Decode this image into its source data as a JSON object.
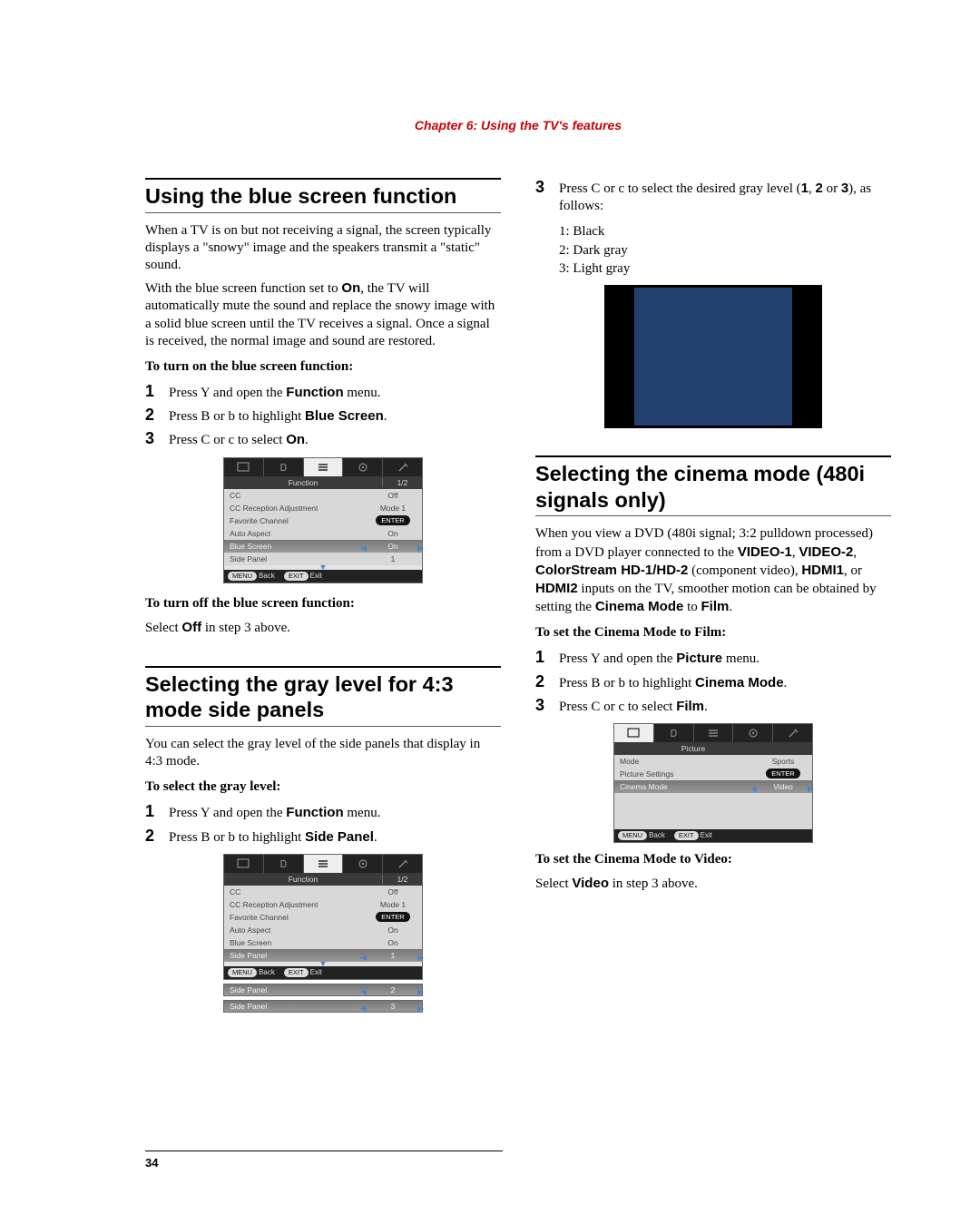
{
  "chapter_title": "Chapter 6: Using the TV's features",
  "page_number": "34",
  "left": {
    "sec1_title": "Using the blue screen function",
    "sec1_p1": "When a TV is on but not receiving a signal, the screen typically displays a \"snowy\" image and the speakers transmit a \"static\" sound.",
    "sec1_p2a": "With the blue screen function set to ",
    "sec1_p2b": "On",
    "sec1_p2c": ", the TV will automatically mute the sound and replace the snowy image with a solid blue screen until the TV receives a signal. Once a signal is received, the normal image and sound are restored.",
    "sec1_bold": "To turn on the blue screen function:",
    "sec1_step1a": "Press ",
    "sec1_step1b": "Y",
    "sec1_step1c": " and open the ",
    "sec1_step1d": "Function",
    "sec1_step1e": " menu.",
    "sec1_step2a": "Press ",
    "sec1_step2b": "B",
    "sec1_step2c": " or ",
    "sec1_step2d": "b",
    "sec1_step2e": " to highlight ",
    "sec1_step2f": "Blue Screen",
    "sec1_step2g": ".",
    "sec1_step3a": "Press ",
    "sec1_step3b": "C",
    "sec1_step3c": " or ",
    "sec1_step3d": "c",
    "sec1_step3e": " to select ",
    "sec1_step3f": "On",
    "sec1_step3g": ".",
    "sec1_off_bold": "To turn off the blue screen function:",
    "sec1_off_body_a": "Select ",
    "sec1_off_body_b": "Off",
    "sec1_off_body_c": " in step 3 above.",
    "sec2_title": "Selecting the gray level for 4:3 mode side panels",
    "sec2_p1": "You can select the gray level of the side panels that display in 4:3 mode.",
    "sec2_bold": "To select the gray level:",
    "sec2_step1a": "Press ",
    "sec2_step1b": "Y",
    "sec2_step1c": " and open the ",
    "sec2_step1d": "Function",
    "sec2_step1e": " menu.",
    "sec2_step2a": "Press ",
    "sec2_step2b": "B",
    "sec2_step2c": " or ",
    "sec2_step2d": "b",
    "sec2_step2e": " to highlight ",
    "sec2_step2f": "Side Panel",
    "sec2_step2g": "."
  },
  "right": {
    "step3a": "Press ",
    "step3b": "C",
    "step3c": " or ",
    "step3d": "c",
    "step3e": " to select the desired gray level (",
    "step3f": "1",
    "step3g": ", ",
    "step3h": "2",
    "step3i": " or ",
    "step3j": "3",
    "step3k": "), as follows:",
    "lvl1": "1: Black",
    "lvl2": "2: Dark gray",
    "lvl3": "3: Light gray",
    "sec3_title": "Selecting the cinema mode (480i signals only)",
    "sec3_p1a": "When you view a DVD (480i signal; 3:2 pulldown processed) from a DVD player connected to the ",
    "sec3_p1b": "VIDEO-1",
    "sec3_p1c": ", ",
    "sec3_p1d": "VIDEO-2",
    "sec3_p1e": ", ",
    "sec3_p1f": "ColorStream HD-1/HD-2",
    "sec3_p1g": " (component video), ",
    "sec3_p1h": "HDMI1",
    "sec3_p1i": ", or ",
    "sec3_p1j": "HDMI2",
    "sec3_p1k": " inputs on the TV, smoother motion can be obtained by setting the ",
    "sec3_p1l": "Cinema Mode",
    "sec3_p1m": " to ",
    "sec3_p1n": "Film",
    "sec3_p1o": ".",
    "sec3_bold": "To set the Cinema Mode to Film:",
    "sec3_step1a": "Press ",
    "sec3_step1b": "Y",
    "sec3_step1c": " and open the ",
    "sec3_step1d": "Picture",
    "sec3_step1e": " menu.",
    "sec3_step2a": "Press ",
    "sec3_step2b": "B",
    "sec3_step2c": " or ",
    "sec3_step2d": "b",
    "sec3_step2e": " to highlight ",
    "sec3_step2f": "Cinema Mode",
    "sec3_step2g": ".",
    "sec3_step3a": "Press ",
    "sec3_step3b": "C",
    "sec3_step3c": " or ",
    "sec3_step3d": "c",
    "sec3_step3e": " to select ",
    "sec3_step3f": "Film",
    "sec3_step3g": ".",
    "sec3_bold2": "To set the Cinema Mode to Video:",
    "sec3_body2a": "Select ",
    "sec3_body2b": "Video",
    "sec3_body2c": " in step 3 above."
  },
  "osd": {
    "function_label": "Function",
    "picture_label": "Picture",
    "page_indicator": "1/2",
    "enter": "ENTER",
    "menu_back": "Back",
    "menu_pill": "MENU",
    "exit_pill": "EXIT",
    "exit": "Exit",
    "func_rows": {
      "cc": "CC",
      "cc_val": "Off",
      "ccra": "CC Reception Adjustment",
      "ccra_val": "Mode 1",
      "fav": "Favorite Channel",
      "aa": "Auto Aspect",
      "aa_val": "On",
      "bs": "Blue Screen",
      "bs_val": "On",
      "sp": "Side Panel",
      "sp_val": "1",
      "sp_val2": "2",
      "sp_val3": "3"
    },
    "pic_rows": {
      "mode": "Mode",
      "mode_val": "Sports",
      "ps": "Picture Settings",
      "cm": "Cinema Mode",
      "cm_val": "Video"
    }
  }
}
